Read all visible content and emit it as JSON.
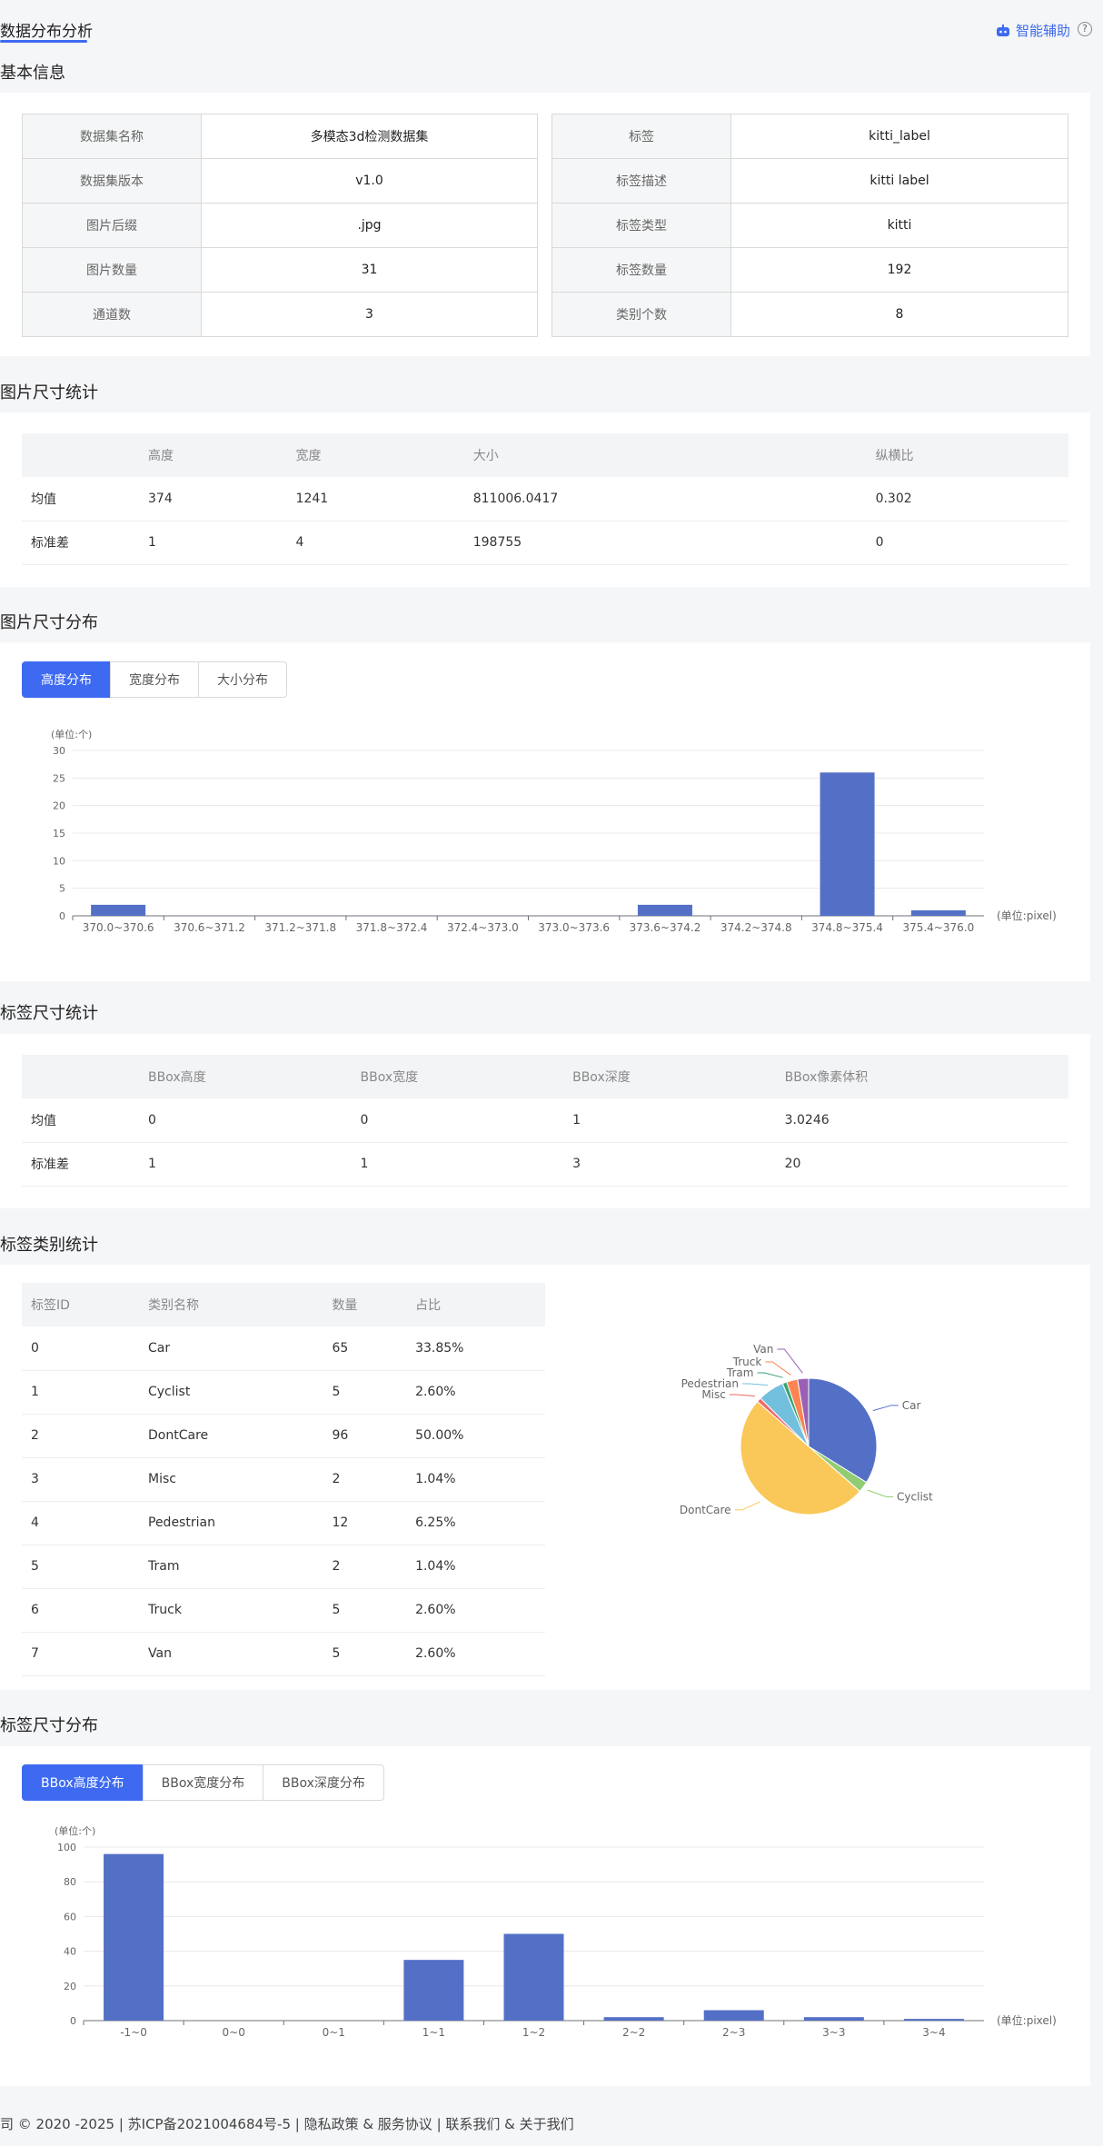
{
  "header": {
    "tab_label": "数据分布分析",
    "assist_label": "智能辅助",
    "help_glyph": "?"
  },
  "basic": {
    "title": "基本信息",
    "left": [
      {
        "k": "数据集名称",
        "v": "多模态3d检测数据集"
      },
      {
        "k": "数据集版本",
        "v": "v1.0"
      },
      {
        "k": "图片后缀",
        "v": ".jpg"
      },
      {
        "k": "图片数量",
        "v": "31"
      },
      {
        "k": "通道数",
        "v": "3"
      }
    ],
    "right": [
      {
        "k": "标签",
        "v": "kitti_label"
      },
      {
        "k": "标签描述",
        "v": "kitti label"
      },
      {
        "k": "标签类型",
        "v": "kitti"
      },
      {
        "k": "标签数量",
        "v": "192"
      },
      {
        "k": "类别个数",
        "v": "8"
      }
    ]
  },
  "img_stats": {
    "title": "图片尺寸统计",
    "headers": [
      "",
      "高度",
      "宽度",
      "大小",
      "纵横比"
    ],
    "rows": [
      [
        "均值",
        "374",
        "1241",
        "811006.0417",
        "0.302"
      ],
      [
        "标准差",
        "1",
        "4",
        "198755",
        "0"
      ]
    ]
  },
  "img_dist": {
    "title": "图片尺寸分布",
    "buttons": [
      "高度分布",
      "宽度分布",
      "大小分布"
    ],
    "active": 0
  },
  "label_stats": {
    "title": "标签尺寸统计",
    "headers": [
      "",
      "BBox高度",
      "BBox宽度",
      "BBox深度",
      "BBox像素体积"
    ],
    "rows": [
      [
        "均值",
        "0",
        "0",
        "1",
        "3.0246"
      ],
      [
        "标准差",
        "1",
        "1",
        "3",
        "20"
      ]
    ]
  },
  "class_stats": {
    "title": "标签类别统计",
    "headers": [
      "标签ID",
      "类别名称",
      "数量",
      "占比"
    ],
    "rows": [
      [
        "0",
        "Car",
        "65",
        "33.85%"
      ],
      [
        "1",
        "Cyclist",
        "5",
        "2.60%"
      ],
      [
        "2",
        "DontCare",
        "96",
        "50.00%"
      ],
      [
        "3",
        "Misc",
        "2",
        "1.04%"
      ],
      [
        "4",
        "Pedestrian",
        "12",
        "6.25%"
      ],
      [
        "5",
        "Tram",
        "2",
        "1.04%"
      ],
      [
        "6",
        "Truck",
        "5",
        "2.60%"
      ],
      [
        "7",
        "Van",
        "5",
        "2.60%"
      ]
    ]
  },
  "label_dist": {
    "title": "标签尺寸分布",
    "buttons": [
      "BBox高度分布",
      "BBox宽度分布",
      "BBox深度分布"
    ],
    "active": 0
  },
  "footer": {
    "text": "司 © 2020 -2025 | 苏ICP备2021004684号-5 | 隐私政策 & 服务协议 | 联系我们  &  关于我们"
  },
  "colors": {
    "accent": "#3d6af0",
    "bar": "#5470c6",
    "pie": [
      "#5470c6",
      "#91cc75",
      "#fac858",
      "#ee6666",
      "#73c0de",
      "#3ba272",
      "#fc8452",
      "#9a60b4"
    ]
  },
  "chart_data": [
    {
      "type": "bar",
      "unit_y": "(单位:个)",
      "unit_x": "(单位:pixel)",
      "categories": [
        "370.0~370.6",
        "370.6~371.2",
        "371.2~371.8",
        "371.8~372.4",
        "372.4~373.0",
        "373.0~373.6",
        "373.6~374.2",
        "374.2~374.8",
        "374.8~375.4",
        "375.4~376.0"
      ],
      "values": [
        2,
        0,
        0,
        0,
        0,
        0,
        2,
        0,
        26,
        1
      ],
      "ylim": [
        0,
        30
      ],
      "yticks": [
        0,
        5,
        10,
        15,
        20,
        25,
        30
      ]
    },
    {
      "type": "pie",
      "categories": [
        "Car",
        "Cyclist",
        "DontCare",
        "Misc",
        "Pedestrian",
        "Tram",
        "Truck",
        "Van"
      ],
      "values": [
        65,
        5,
        96,
        2,
        12,
        2,
        5,
        5
      ]
    },
    {
      "type": "bar",
      "unit_y": "(单位:个)",
      "unit_x": "(单位:pixel)",
      "categories": [
        "-1~0",
        "0~0",
        "0~1",
        "1~1",
        "1~2",
        "2~2",
        "2~3",
        "3~3",
        "3~4"
      ],
      "values": [
        96,
        0,
        0,
        35,
        50,
        2,
        6,
        2,
        1
      ],
      "ylim": [
        0,
        100
      ],
      "yticks": [
        0,
        20,
        40,
        60,
        80,
        100
      ]
    }
  ]
}
